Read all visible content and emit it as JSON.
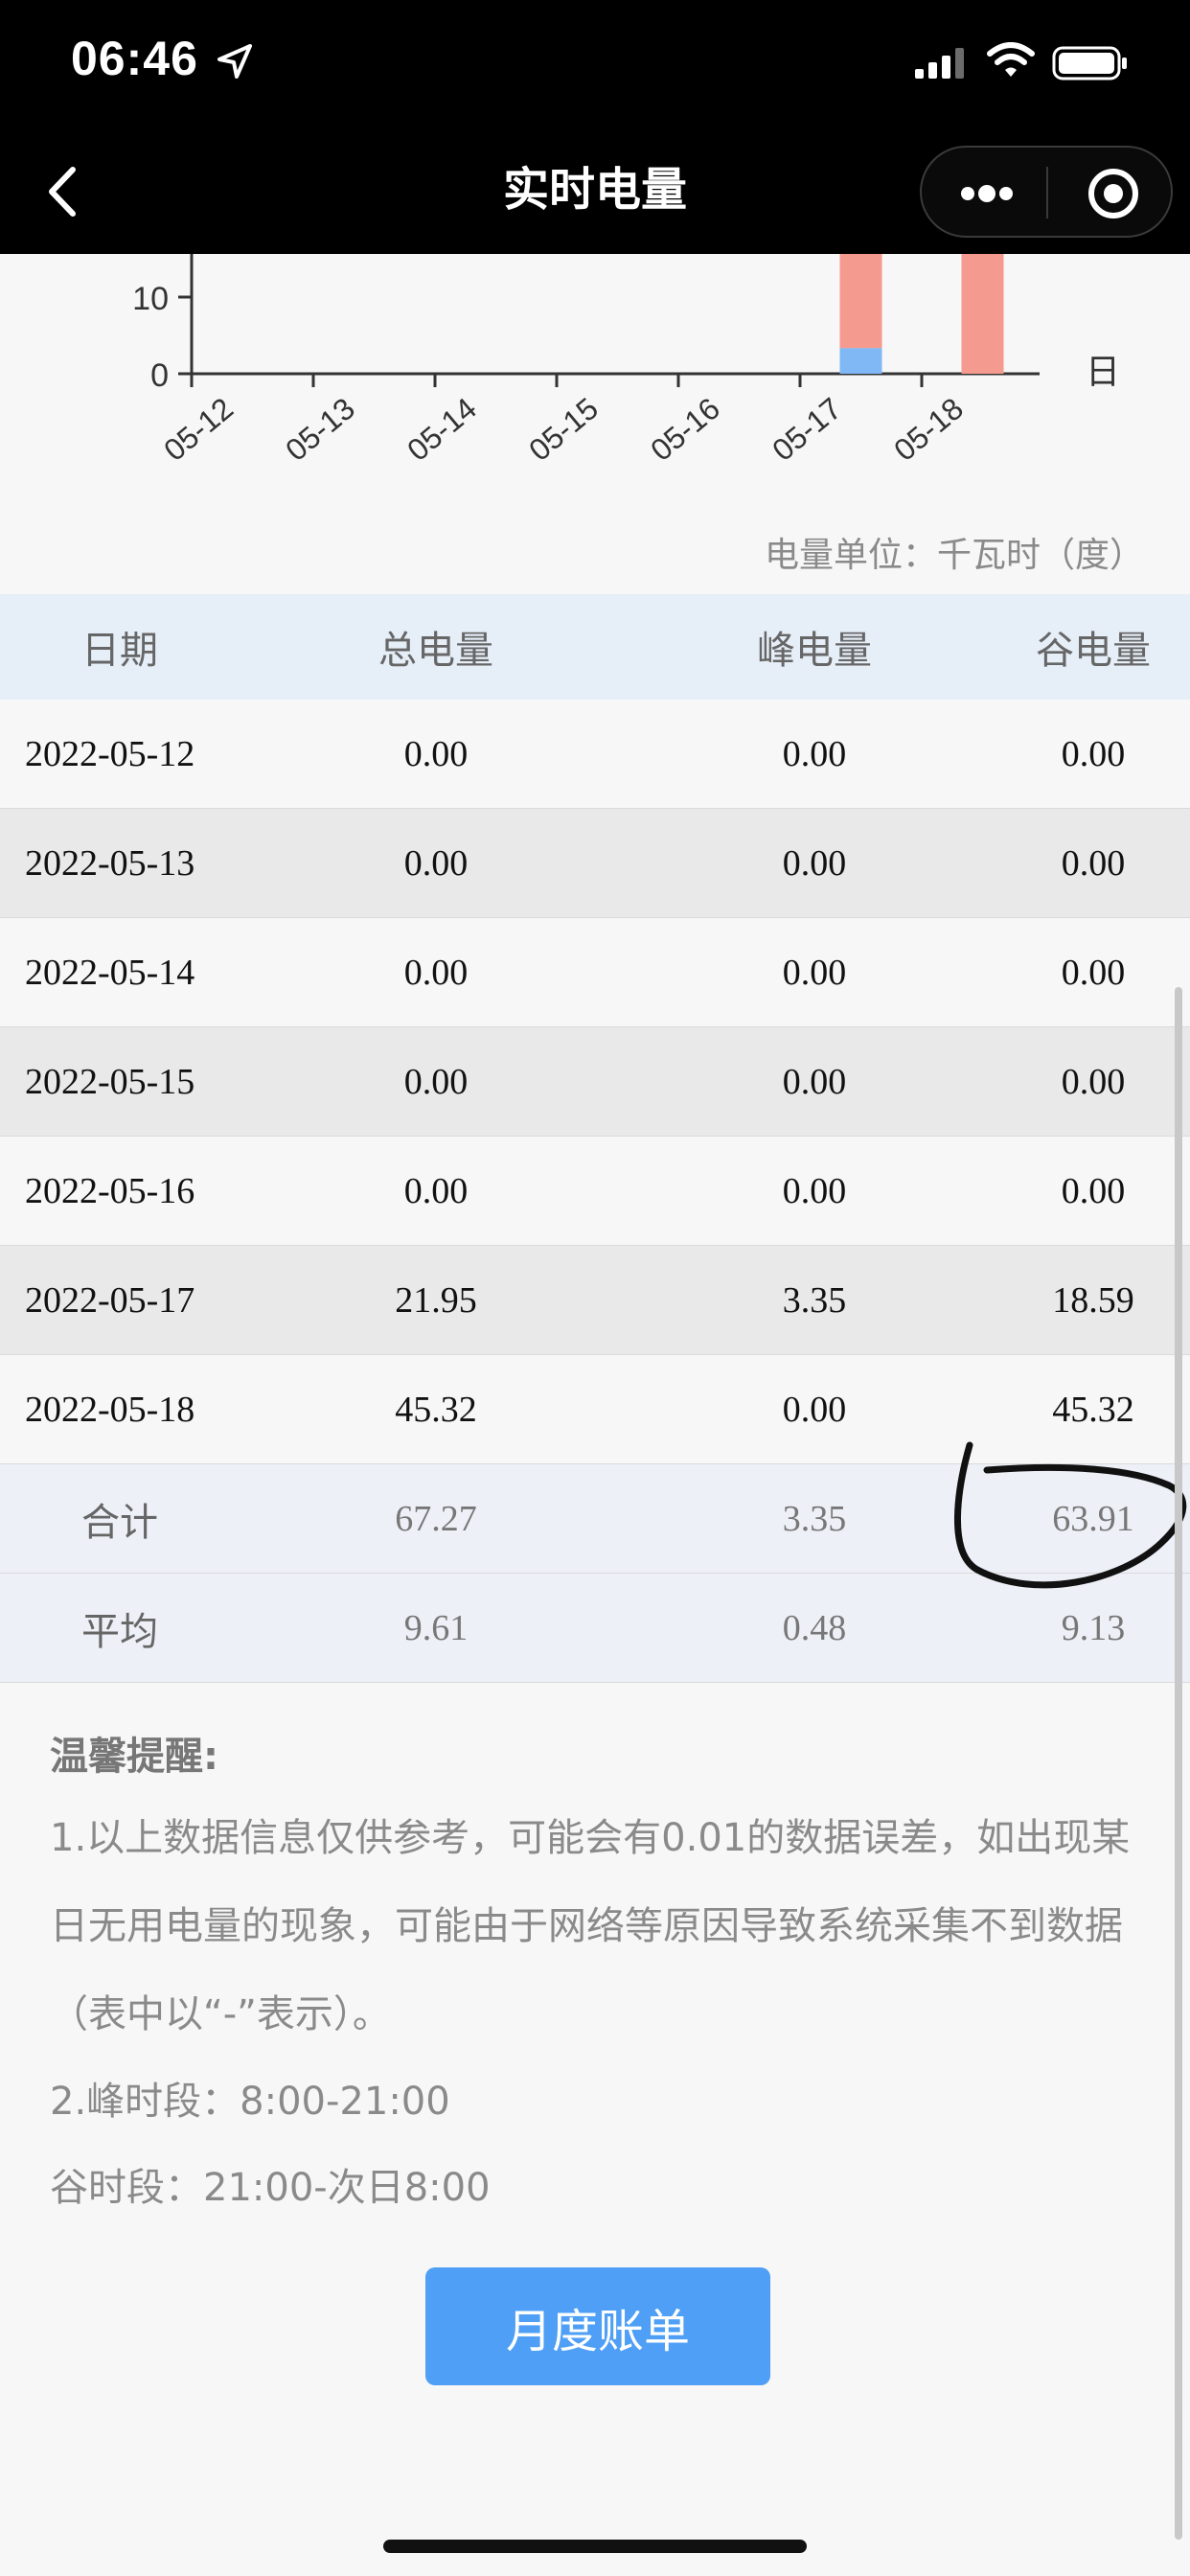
{
  "status_bar": {
    "time": "06:46"
  },
  "nav": {
    "title": "实时电量"
  },
  "chart_data": {
    "type": "bar",
    "stacked": true,
    "categories": [
      "05-12",
      "05-13",
      "05-14",
      "05-15",
      "05-16",
      "05-17",
      "05-18"
    ],
    "series": [
      {
        "name": "峰电量",
        "color": "#7fb8f5",
        "values": [
          0,
          0,
          0,
          0,
          0,
          3.35,
          0
        ]
      },
      {
        "name": "谷电量",
        "color": "#f49a8f",
        "values": [
          0,
          0,
          0,
          0,
          0,
          18.59,
          45.32
        ]
      }
    ],
    "y_ticks_visible": [
      "0",
      "10"
    ],
    "x_unit": "日"
  },
  "unit_note": "电量单位：千瓦时（度）",
  "table": {
    "headers": [
      "日期",
      "总电量",
      "峰电量",
      "谷电量"
    ],
    "rows": [
      [
        "2022-05-12",
        "0.00",
        "0.00",
        "0.00"
      ],
      [
        "2022-05-13",
        "0.00",
        "0.00",
        "0.00"
      ],
      [
        "2022-05-14",
        "0.00",
        "0.00",
        "0.00"
      ],
      [
        "2022-05-15",
        "0.00",
        "0.00",
        "0.00"
      ],
      [
        "2022-05-16",
        "0.00",
        "0.00",
        "0.00"
      ],
      [
        "2022-05-17",
        "21.95",
        "3.35",
        "18.59"
      ],
      [
        "2022-05-18",
        "45.32",
        "0.00",
        "45.32"
      ]
    ],
    "total": [
      "合计",
      "67.27",
      "3.35",
      "63.91"
    ],
    "average": [
      "平均",
      "9.61",
      "0.48",
      "9.13"
    ]
  },
  "tips": {
    "title": "温馨提醒:",
    "p1": "1.以上数据信息仅供参考，可能会有0.01的数据误差，如出现某日无用电量的现象，可能由于网络等原因导致系统采集不到数据（表中以“-”表示）。",
    "p2": "2.峰时段：8:00-21:00",
    "p3": "谷时段：21:00-次日8:00"
  },
  "month_button_label": "月度账单"
}
